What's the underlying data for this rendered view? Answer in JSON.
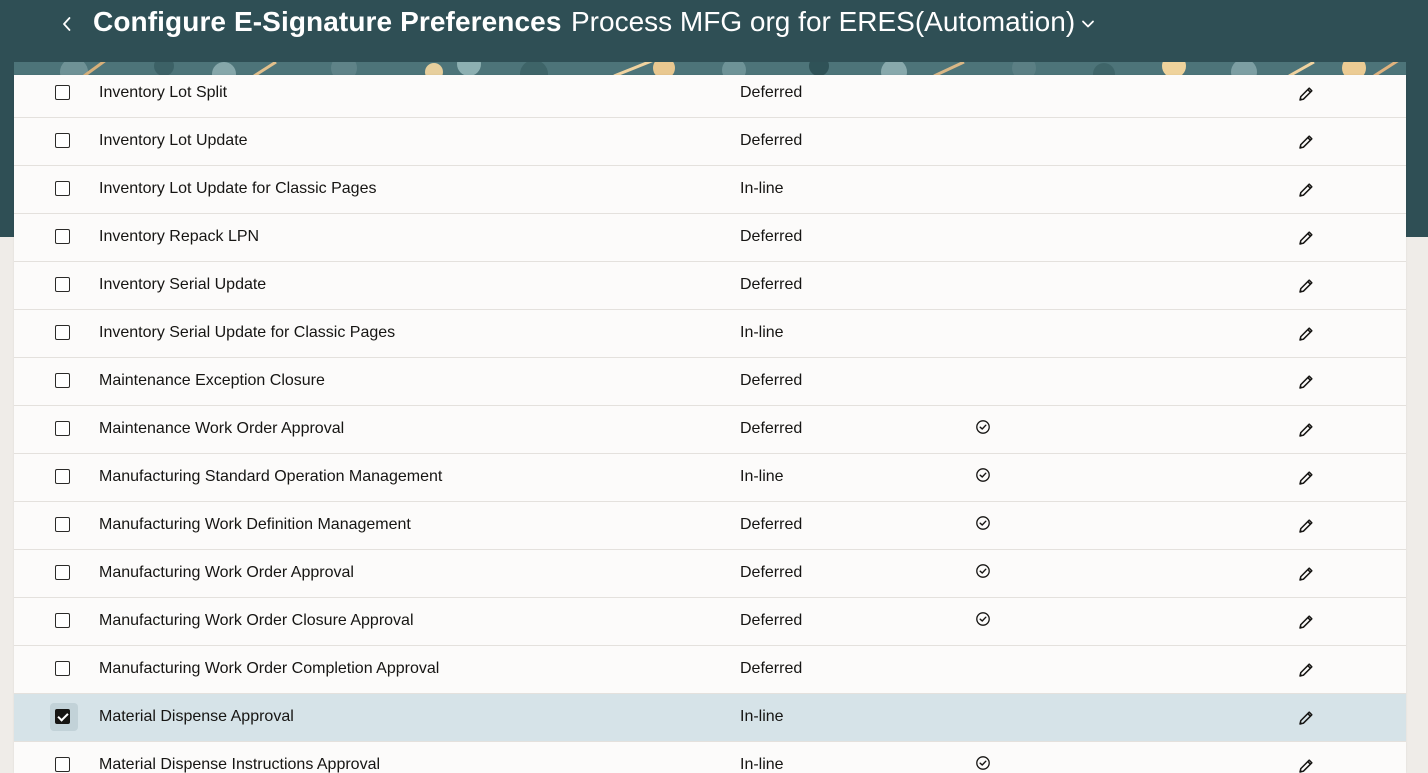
{
  "header": {
    "back_icon": "chevron-left-icon",
    "title": "Configure E-Signature Preferences",
    "org_name": "Process MFG org for ERES(Automation)",
    "org_dropdown_icon": "chevron-down-icon"
  },
  "colors": {
    "header_bg": "#2f4f55",
    "selected_row_bg": "#d6e3e8",
    "text": "#161513"
  },
  "rows": [
    {
      "name": "Inventory Lot Split",
      "mode": "Deferred",
      "flag": false,
      "selected": false
    },
    {
      "name": "Inventory Lot Update",
      "mode": "Deferred",
      "flag": false,
      "selected": false
    },
    {
      "name": "Inventory Lot Update for Classic Pages",
      "mode": "In-line",
      "flag": false,
      "selected": false
    },
    {
      "name": "Inventory Repack LPN",
      "mode": "Deferred",
      "flag": false,
      "selected": false
    },
    {
      "name": "Inventory Serial Update",
      "mode": "Deferred",
      "flag": false,
      "selected": false
    },
    {
      "name": "Inventory Serial Update for Classic Pages",
      "mode": "In-line",
      "flag": false,
      "selected": false
    },
    {
      "name": "Maintenance Exception Closure",
      "mode": "Deferred",
      "flag": false,
      "selected": false
    },
    {
      "name": "Maintenance Work Order Approval",
      "mode": "Deferred",
      "flag": true,
      "selected": false
    },
    {
      "name": "Manufacturing Standard Operation Management",
      "mode": "In-line",
      "flag": true,
      "selected": false
    },
    {
      "name": "Manufacturing Work Definition Management",
      "mode": "Deferred",
      "flag": true,
      "selected": false
    },
    {
      "name": "Manufacturing Work Order Approval",
      "mode": "Deferred",
      "flag": true,
      "selected": false
    },
    {
      "name": "Manufacturing Work Order Closure Approval",
      "mode": "Deferred",
      "flag": true,
      "selected": false
    },
    {
      "name": "Manufacturing Work Order Completion Approval",
      "mode": "Deferred",
      "flag": false,
      "selected": false
    },
    {
      "name": "Material Dispense Approval",
      "mode": "In-line",
      "flag": false,
      "selected": true
    },
    {
      "name": "Material Dispense Instructions Approval",
      "mode": "In-line",
      "flag": true,
      "selected": false
    }
  ],
  "icons": {
    "checkbox": "checkbox-icon",
    "flag": "check-circle-icon",
    "edit": "pencil-icon"
  }
}
